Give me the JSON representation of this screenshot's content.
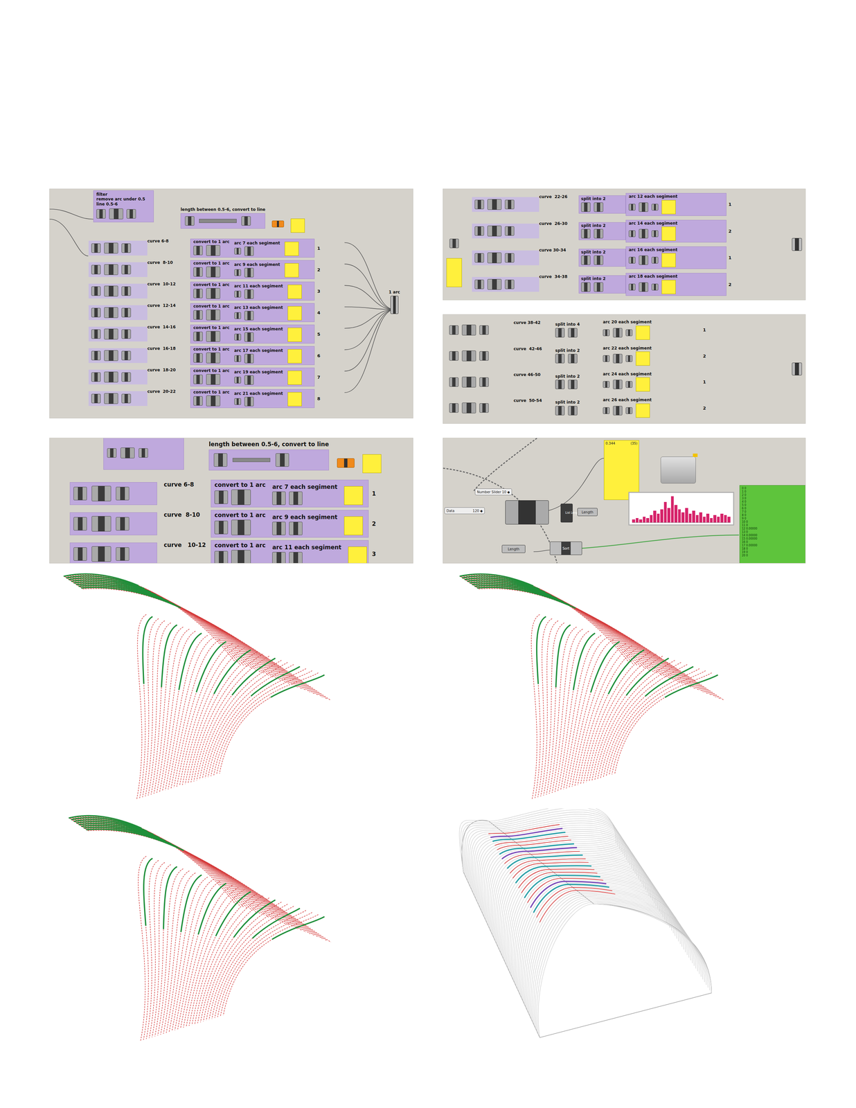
{
  "arc_panel": {
    "filter": [
      "filter",
      "remove arc under 0.5",
      "line 0.5-6"
    ],
    "line_label": "length between 0.5-6, convert to line",
    "merge_label": "1 arc",
    "rows": [
      {
        "curve": "curve 6-8",
        "convert": "convert to 1 arc",
        "arc": "arc 7 each segiment",
        "index": "1"
      },
      {
        "curve": "curve  8-10",
        "convert": "convert to 1 arc",
        "arc": "arc 9 each segiment",
        "index": "2"
      },
      {
        "curve": "curve  10-12",
        "convert": "convert to 1 arc",
        "arc": "arc 11 each segiment",
        "index": "3"
      },
      {
        "curve": "curve  12-14",
        "convert": "convert to 1 arc",
        "arc": "arc 13 each segiment",
        "index": "4"
      },
      {
        "curve": "curve  14-16",
        "convert": "convert to 1 arc",
        "arc": "arc 15 each segiment",
        "index": "5"
      },
      {
        "curve": "curve  16-18",
        "convert": "convert to 1 arc",
        "arc": "arc 17 each segiment",
        "index": "6"
      },
      {
        "curve": "curve  18-20",
        "convert": "convert to 1 arc",
        "arc": "arc 19 each segiment",
        "index": "7"
      },
      {
        "curve": "curve  20-22",
        "convert": "convert to 1 arc",
        "arc": "arc 21 each segiment",
        "index": "8"
      }
    ]
  },
  "split_panels": [
    {
      "kind": "grouped",
      "rows": [
        {
          "curve": "curve  22-26",
          "split": "split into 2",
          "arc": "arc 12 each segiment",
          "index": "1"
        },
        {
          "curve": "curve  26-30",
          "split": "split into 2",
          "arc": "arc 14 each segiment",
          "index": "2"
        },
        {
          "curve": "curve 30-34",
          "split": "split into 2",
          "arc": "arc 16 each segiment",
          "index": "1"
        },
        {
          "curve": "curve  34-38",
          "split": "split into 2",
          "arc": "arc 18 each segiment",
          "index": "2"
        }
      ]
    },
    {
      "kind": "plain",
      "rows": [
        {
          "curve": "curve 38-42",
          "split": "split into 4",
          "arc": "arc 20 each segiment",
          "index": "1"
        },
        {
          "curve": "curve  42-46",
          "split": "split into 2",
          "arc": "arc 22 each segiment",
          "index": "2"
        },
        {
          "curve": "curve 46-50",
          "split": "split into 2",
          "arc": "arc 24 each segiment",
          "index": "1"
        },
        {
          "curve": "curve  50-54",
          "split": "split into 2",
          "arc": "arc 26 each segiment",
          "index": "2"
        }
      ]
    }
  ],
  "zoom_panel": {
    "line_label": "length between 0.5-6, convert to line",
    "rows": [
      {
        "curve": "curve 6-8",
        "convert": "convert to 1 arc",
        "arc": "arc 7 each segiment",
        "index": "1"
      },
      {
        "curve": "curve  8-10",
        "convert": "convert to 1 arc",
        "arc": "arc 9 each segiment",
        "index": "2"
      },
      {
        "curve": "curve   10-12",
        "convert": "convert to 1 arc",
        "arc": "arc 11 each segiment",
        "index": "3"
      }
    ]
  },
  "histogram_panel": {
    "slider_label": "Number Slider",
    "slider_value": "10 ◆",
    "data_label": "Data",
    "data_value": "120 ◆",
    "panel_value": "0.344",
    "panel_count": "(35)",
    "components": [
      "Length",
      "List Length",
      "Sort",
      "Length"
    ],
    "bars": [
      2,
      3,
      2,
      4,
      3,
      5,
      8,
      6,
      9,
      14,
      10,
      18,
      12,
      9,
      7,
      10,
      6,
      8,
      5,
      7,
      4,
      6,
      3,
      5,
      4,
      6,
      5,
      4
    ],
    "list": [
      "0 0",
      "1 0",
      "2 0",
      "3 0",
      "4 0",
      "5 0",
      "6 0",
      "7 0",
      "8 0",
      "9 0",
      "10 0",
      "11 0",
      "12 0.00000",
      "13 0",
      "14 0.00000",
      "15 0.00000",
      "16 0",
      "17 0.00000",
      "18 0",
      "19 0",
      "20 0"
    ]
  },
  "figures": [
    {
      "kind": "sweep"
    },
    {
      "kind": "sweep"
    },
    {
      "kind": "sweep"
    },
    {
      "kind": "shell"
    }
  ]
}
